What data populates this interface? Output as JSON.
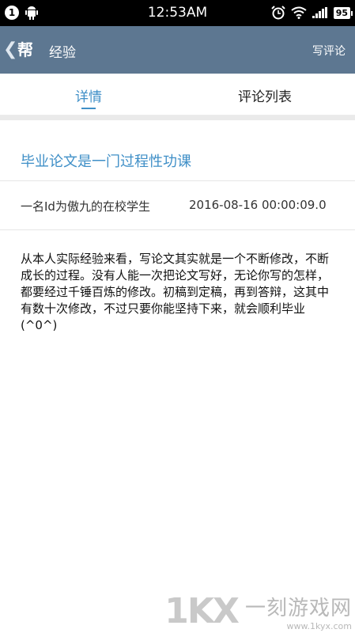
{
  "status_bar": {
    "notification_count": "1",
    "time": "12:53AM",
    "battery": "95",
    "icons": [
      "android-icon",
      "alarm-icon",
      "wifi-icon",
      "signal-icon",
      "battery-icon"
    ]
  },
  "header": {
    "back_icon": "chevron-left-icon",
    "logo_text": "帮",
    "title": "经验",
    "write_review": "写评论"
  },
  "tabs": [
    {
      "label": "详情",
      "active": true
    },
    {
      "label": "评论列表",
      "active": false
    }
  ],
  "article": {
    "title": "毕业论文是一门过程性功课",
    "author": "一名Id为傲九的在校学生",
    "date": "2016-08-16 00:00:09.0",
    "body": "从本人实际经验来看，写论文其实就是一个不断修改，不断成长的过程。没有人能一次把论文写好，无论你写的怎样，都要经过千锤百炼的修改。初稿到定稿，再到答辩，这其中有数十次修改，不过只要你能坚持下来，就会顺利毕业(^0^)"
  },
  "watermark": {
    "logo": "1KX",
    "name": "一刻游戏网",
    "url": "www.1kyx.com"
  },
  "colors": {
    "header_bg": "#5d7791",
    "accent": "#3f8fc7"
  }
}
